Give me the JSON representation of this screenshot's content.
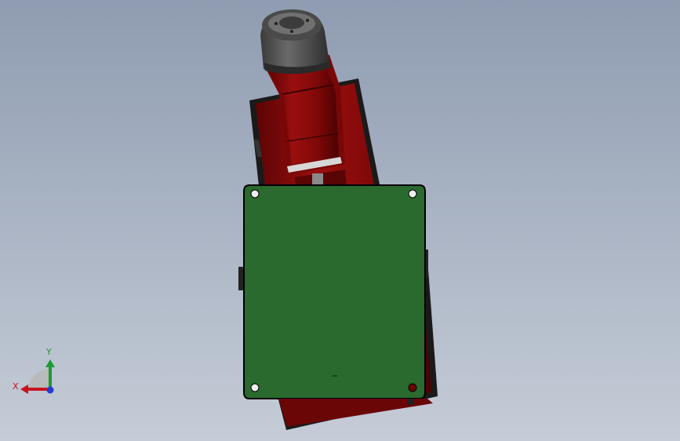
{
  "viewport": {
    "background_top": "#8f9cb1",
    "background_bottom": "#c5ccd7"
  },
  "model": {
    "body_color": "#8b0a0a",
    "plate_color": "#2a6a2e",
    "cap_color": "#5b5b5b"
  },
  "triad": {
    "x_label": "X",
    "y_label": "Y",
    "x_color": "#c8141e",
    "y_color": "#1d9a2f",
    "z_color": "#1f3fd0"
  }
}
